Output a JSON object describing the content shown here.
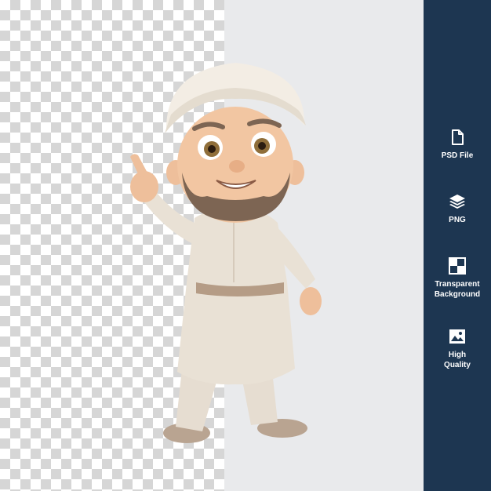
{
  "sidebar": {
    "background": "#1d3651",
    "features": [
      {
        "icon": "file-icon",
        "label": "PSD File"
      },
      {
        "icon": "layers-icon",
        "label": "PNG"
      },
      {
        "icon": "transparency-icon",
        "label": "Transparent\nBackground"
      },
      {
        "icon": "image-icon",
        "label": "High\nQuality"
      }
    ]
  },
  "preview": {
    "character": "cartoon-man-in-white-kufi-pointing",
    "checker_color": "#d6d6d6",
    "solid_color": "#e9eaec"
  }
}
